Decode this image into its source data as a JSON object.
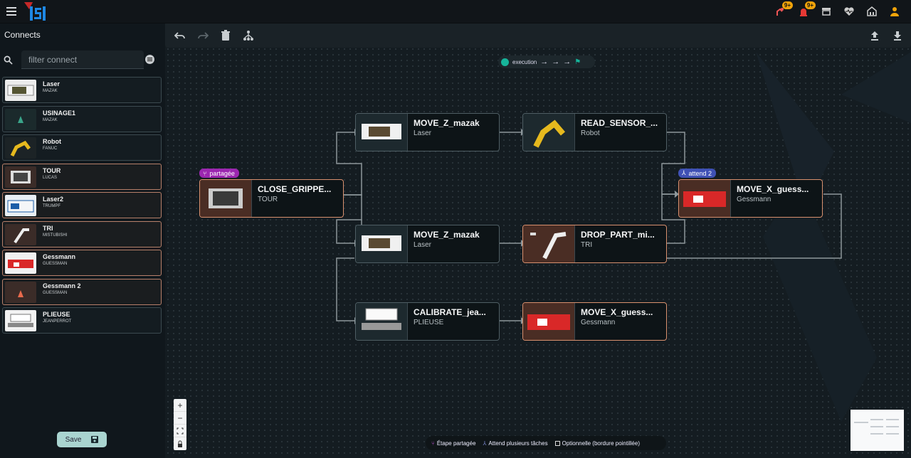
{
  "header": {
    "notification_badges": [
      "9+",
      "9+"
    ],
    "icons": [
      "robot-alert-icon",
      "alarm-icon",
      "store-icon",
      "heart-monitor-icon",
      "home-icon",
      "user-icon"
    ]
  },
  "sidebar": {
    "title": "Connects",
    "filter": {
      "placeholder": "filter connect",
      "value": ""
    },
    "items": [
      {
        "name": "Laser",
        "sub": "MAZAK"
      },
      {
        "name": "USINAGE1",
        "sub": "MAZAK"
      },
      {
        "name": "Robot",
        "sub": "FANUC"
      },
      {
        "name": "TOUR",
        "sub": "LUCAS"
      },
      {
        "name": "Laser2",
        "sub": "TRUMPF"
      },
      {
        "name": "TRI",
        "sub": "MISTUBISHI"
      },
      {
        "name": "Gessmann",
        "sub": "GUESSMAN"
      },
      {
        "name": "Gessmann 2",
        "sub": "GUESSMAN"
      },
      {
        "name": "PLIEUSE",
        "sub": "JEANPERROT"
      }
    ],
    "save_label": "Save"
  },
  "toolbar": {
    "left_icons": [
      "undo-icon",
      "redo-icon",
      "delete-icon",
      "layout-tree-icon"
    ],
    "right_icons": [
      "upload-icon",
      "download-icon"
    ]
  },
  "execution": {
    "label": "execution"
  },
  "nodes": {
    "close": {
      "title": "CLOSE_GRIPPE...",
      "sub": "TOUR",
      "tag": "partagée"
    },
    "mz1": {
      "title": "MOVE_Z_mazak",
      "sub": "Laser"
    },
    "mz2": {
      "title": "MOVE_Z_mazak",
      "sub": "Laser"
    },
    "read": {
      "title": "READ_SENSOR_...",
      "sub": "Robot"
    },
    "drop": {
      "title": "DROP_PART_mi...",
      "sub": "TRI"
    },
    "calib": {
      "title": "CALIBRATE_jea...",
      "sub": "PLIEUSE"
    },
    "mx1": {
      "title": "MOVE_X_guess...",
      "sub": "Gessmann"
    },
    "mx2": {
      "title": "MOVE_X_guess...",
      "sub": "Gessmann",
      "tag": "attend 2"
    }
  },
  "zoom": [
    "+",
    "−"
  ],
  "legend": {
    "shared": "Étape partagée",
    "multi": "Attend plusieurs tâches",
    "optional": "Optionnelle (bordure pointillée)"
  },
  "colors": {
    "accent": "#16b49a",
    "shared_tag": "#9c27b0",
    "wait_tag": "#3f51b5",
    "peach_border": "#d8906e",
    "badge": "#f0a30a"
  }
}
